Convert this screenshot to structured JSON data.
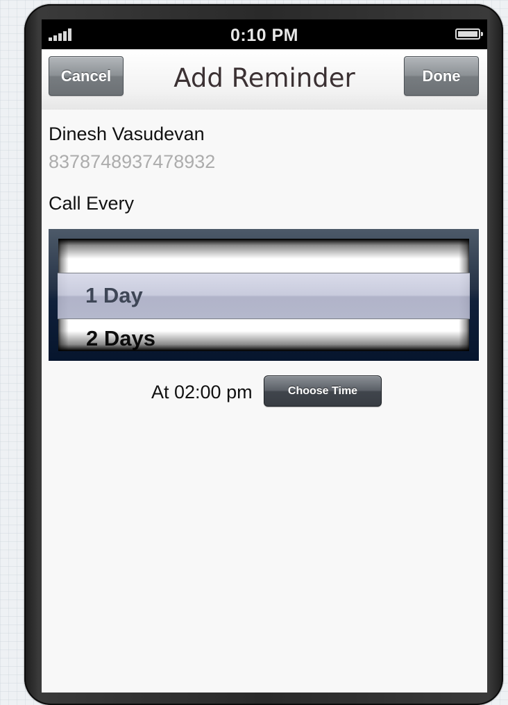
{
  "status_bar": {
    "time": "0:10 PM",
    "signal_icon": "signal-bars-icon",
    "battery_icon": "battery-full-icon"
  },
  "nav": {
    "title": "Add Reminder",
    "cancel_label": "Cancel",
    "done_label": "Done"
  },
  "contact": {
    "name": "Dinesh Vasudevan",
    "phone": "8378748937478932"
  },
  "reminder": {
    "call_label": "Call Every",
    "picker": {
      "selected": "1 Day",
      "next_option": "2 Days"
    },
    "time_label": "At 02:00 pm",
    "choose_time_label": "Choose Time"
  },
  "colors": {
    "nav_button": "#8c9195",
    "picker_frame": "#253246",
    "phone_text_muted": "#acacac"
  }
}
